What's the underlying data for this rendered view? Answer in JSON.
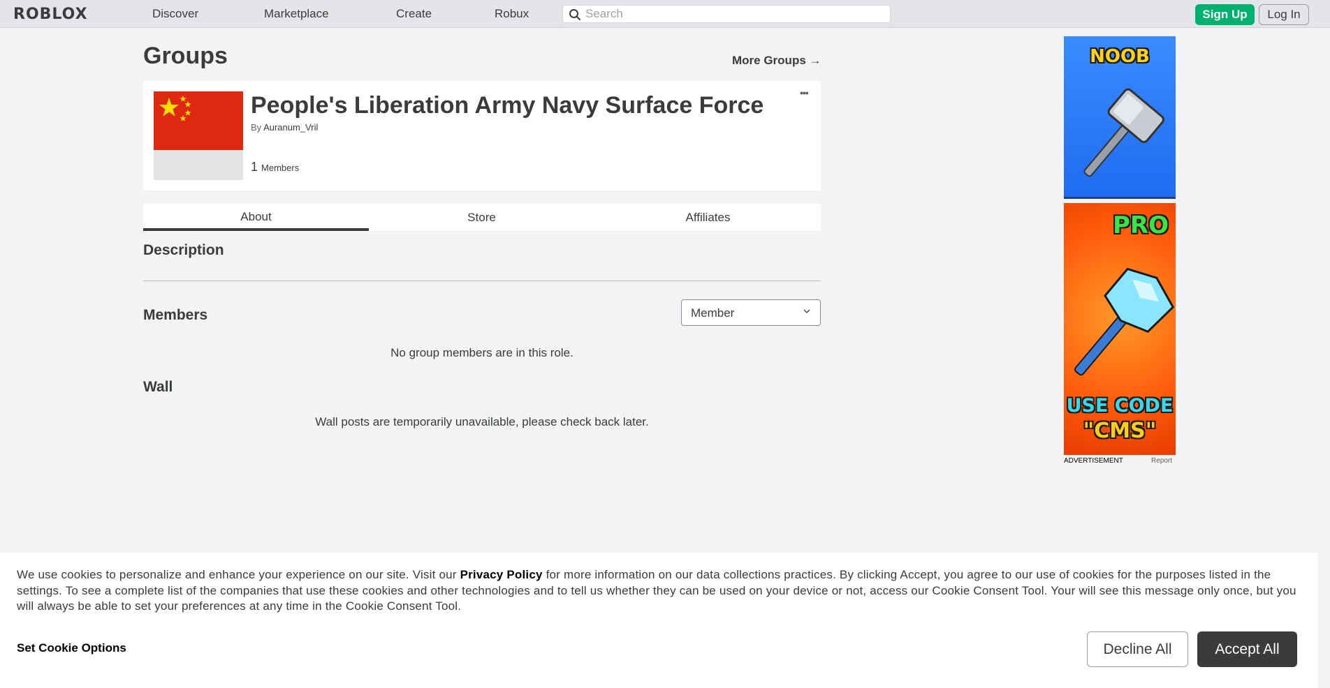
{
  "header": {
    "logo": "ROBLOX",
    "nav": [
      "Discover",
      "Marketplace",
      "Create",
      "Robux"
    ],
    "search_placeholder": "Search",
    "signup_label": "Sign Up",
    "login_label": "Log In"
  },
  "page": {
    "title": "Groups",
    "more_groups": "More Groups",
    "more_groups_arrow": "→"
  },
  "group": {
    "name": "People's Liberation Army Navy Surface Force",
    "by_label": "By",
    "owner": "Auranum_Vril",
    "member_count": "1",
    "members_label": "Members",
    "more_menu": "•••"
  },
  "tabs": [
    "About",
    "Store",
    "Affiliates"
  ],
  "about": {
    "description_title": "Description",
    "members_title": "Members",
    "role_selected": "Member",
    "no_members_msg": "No group members are in this role.",
    "wall_title": "Wall",
    "wall_msg": "Wall posts are temporarily unavailable, please check back later."
  },
  "ads": {
    "noob_text": "NOOB",
    "pro_text": "PRO",
    "use_code_line1": "USE CODE",
    "use_code_line2": "\"CMS\"",
    "label": "ADVERTISEMENT",
    "report": "Report"
  },
  "cookie": {
    "text_before": "We use cookies to personalize and enhance your experience on our site. Visit our ",
    "policy_link": "Privacy Policy",
    "text_after": " for more information on our data collections practices. By clicking Accept, you agree to our use of cookies for the purposes listed in the settings. To see a complete list of the companies that use these cookies and other technologies and to tell us whether they can be used on your device or not, access our Cookie Consent Tool. Your will see this message only once, but you will always be able to set your preferences at any time in the Cookie Consent Tool.",
    "set_options": "Set Cookie Options",
    "decline": "Decline All",
    "accept": "Accept All"
  },
  "colors": {
    "signup_green": "#00b06f",
    "flag_red": "#de2910",
    "flag_star": "#ffde00",
    "accept_dark": "#393b3d"
  }
}
